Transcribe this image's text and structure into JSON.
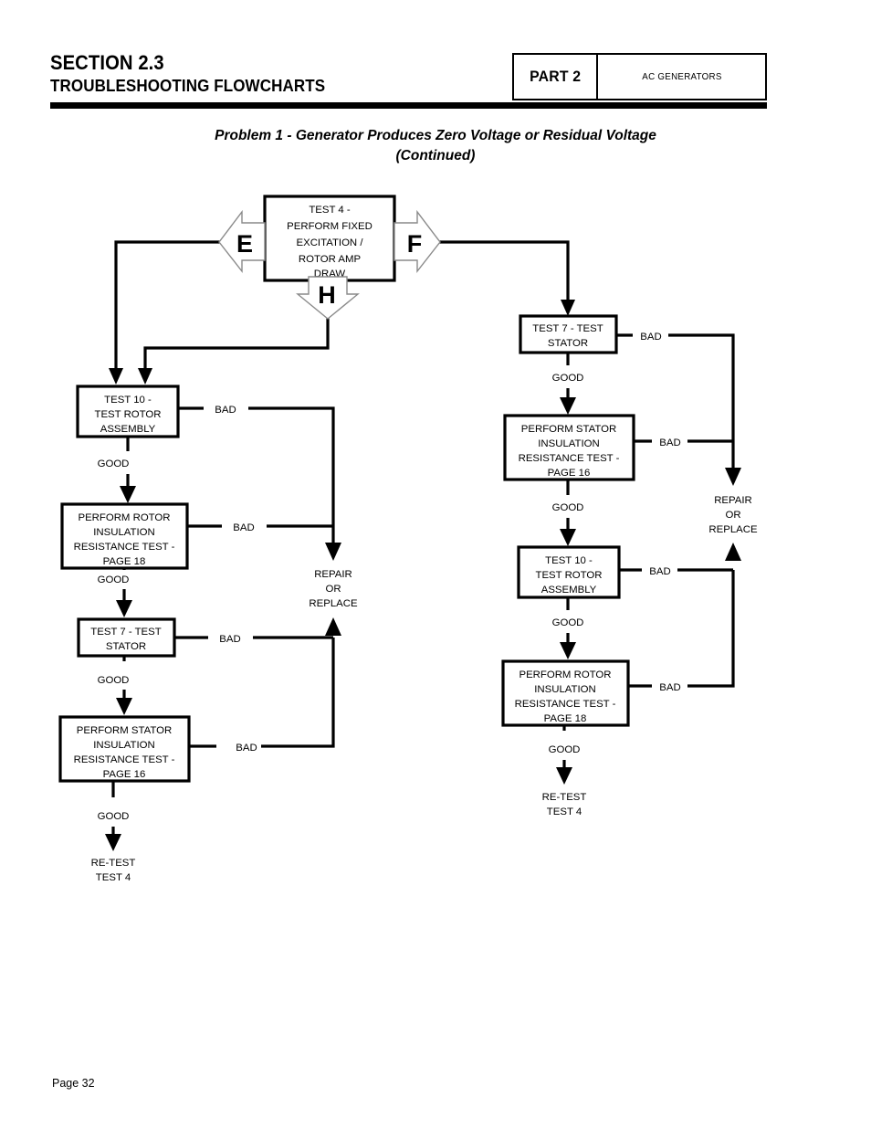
{
  "header": {
    "section_number": "SECTION 2.3",
    "section_subtitle": "TROUBLESHOOTING FLOWCHARTS",
    "part_label": "PART 2",
    "part_description": "AC GENERATORS"
  },
  "problem_title": {
    "line1": "Problem 1 - Generator Produces Zero Voltage or Residual Voltage",
    "line2": "(Continued)"
  },
  "footer": {
    "page": "Page 32"
  },
  "chart_data": {
    "type": "diagram",
    "title": "Problem 1 - Generator Produces Zero Voltage or Residual Voltage (Continued)",
    "diagram_kind": "troubleshooting-flowchart",
    "nodes": [
      {
        "id": "test4",
        "kind": "process",
        "lines": [
          "TEST 4 -",
          "PERFORM FIXED",
          "EXCITATION /",
          "ROTOR AMP",
          "DRAW"
        ]
      },
      {
        "id": "connE",
        "kind": "connector",
        "letter": "E",
        "direction": "left"
      },
      {
        "id": "connF",
        "kind": "connector",
        "letter": "F",
        "direction": "right"
      },
      {
        "id": "connH",
        "kind": "connector",
        "letter": "H",
        "direction": "down"
      },
      {
        "id": "L1",
        "kind": "process",
        "lines": [
          "TEST 10 -",
          "TEST ROTOR",
          "ASSEMBLY"
        ]
      },
      {
        "id": "L2",
        "kind": "process",
        "lines": [
          "PERFORM ROTOR",
          "INSULATION",
          "RESISTANCE TEST -",
          "PAGE  18"
        ]
      },
      {
        "id": "L3",
        "kind": "process",
        "lines": [
          "TEST 7 - TEST",
          "STATOR"
        ]
      },
      {
        "id": "L4",
        "kind": "process",
        "lines": [
          "PERFORM STATOR",
          "INSULATION",
          "RESISTANCE TEST -",
          "PAGE  16"
        ]
      },
      {
        "id": "L5",
        "kind": "terminal",
        "lines": [
          "RE-TEST",
          "TEST 4"
        ]
      },
      {
        "id": "Lrepair",
        "kind": "terminal",
        "lines": [
          "REPAIR",
          "OR",
          "REPLACE"
        ]
      },
      {
        "id": "R1",
        "kind": "process",
        "lines": [
          "TEST 7 - TEST",
          "STATOR"
        ]
      },
      {
        "id": "R2",
        "kind": "process",
        "lines": [
          "PERFORM STATOR",
          "INSULATION",
          "RESISTANCE TEST -",
          "PAGE  16"
        ]
      },
      {
        "id": "R3",
        "kind": "process",
        "lines": [
          "TEST 10 -",
          "TEST ROTOR",
          "ASSEMBLY"
        ]
      },
      {
        "id": "R4",
        "kind": "process",
        "lines": [
          "PERFORM ROTOR",
          "INSULATION",
          "RESISTANCE TEST -",
          "PAGE  18"
        ]
      },
      {
        "id": "R5",
        "kind": "terminal",
        "lines": [
          "RE-TEST",
          "TEST 4"
        ]
      },
      {
        "id": "Rrepair",
        "kind": "terminal",
        "lines": [
          "REPAIR",
          "OR",
          "REPLACE"
        ]
      }
    ],
    "edges": [
      {
        "from": "connE",
        "to": "L1",
        "label": ""
      },
      {
        "from": "connH",
        "to": "L1",
        "label": ""
      },
      {
        "from": "connF",
        "to": "R1",
        "label": ""
      },
      {
        "from": "L1",
        "to": "Lrepair",
        "label": "BAD"
      },
      {
        "from": "L1",
        "to": "L2",
        "label": "GOOD"
      },
      {
        "from": "L2",
        "to": "Lrepair",
        "label": "BAD"
      },
      {
        "from": "L2",
        "to": "L3",
        "label": "GOOD"
      },
      {
        "from": "L3",
        "to": "Lrepair",
        "label": "BAD"
      },
      {
        "from": "L3",
        "to": "L4",
        "label": "GOOD"
      },
      {
        "from": "L4",
        "to": "Lrepair",
        "label": "BAD"
      },
      {
        "from": "L4",
        "to": "L5",
        "label": "GOOD"
      },
      {
        "from": "R1",
        "to": "Rrepair",
        "label": "BAD"
      },
      {
        "from": "R1",
        "to": "R2",
        "label": "GOOD"
      },
      {
        "from": "R2",
        "to": "Rrepair",
        "label": "BAD"
      },
      {
        "from": "R2",
        "to": "R3",
        "label": "GOOD"
      },
      {
        "from": "R3",
        "to": "Rrepair",
        "label": "BAD"
      },
      {
        "from": "R3",
        "to": "R4",
        "label": "GOOD"
      },
      {
        "from": "R4",
        "to": "Rrepair",
        "label": "BAD"
      },
      {
        "from": "R4",
        "to": "R5",
        "label": "GOOD"
      }
    ]
  },
  "flow": {
    "test4": {
      "l1": "TEST 4 -",
      "l2": "PERFORM FIXED",
      "l3": "EXCITATION /",
      "l4": "ROTOR AMP",
      "l5": "DRAW"
    },
    "conn_e": "E",
    "conn_f": "F",
    "conn_h": "H",
    "left": {
      "n1": {
        "l1": "TEST 10 -",
        "l2": "TEST ROTOR",
        "l3": "ASSEMBLY"
      },
      "n1_bad": "BAD",
      "n1_good": "GOOD",
      "n2": {
        "l1": "PERFORM ROTOR",
        "l2": "INSULATION",
        "l3": "RESISTANCE TEST -",
        "l4": "PAGE  18"
      },
      "n2_bad": "BAD",
      "n2_good": "GOOD",
      "n3": {
        "l1": "TEST 7 - TEST",
        "l2": "STATOR"
      },
      "n3_bad": "BAD",
      "n3_good": "GOOD",
      "n4": {
        "l1": "PERFORM STATOR",
        "l2": "INSULATION",
        "l3": "RESISTANCE TEST -",
        "l4": "PAGE  16"
      },
      "n4_bad": "BAD",
      "n4_good": "GOOD",
      "end": {
        "l1": "RE-TEST",
        "l2": "TEST 4"
      },
      "repair": {
        "l1": "REPAIR",
        "l2": "OR",
        "l3": "REPLACE"
      }
    },
    "right": {
      "n1": {
        "l1": "TEST 7 - TEST",
        "l2": "STATOR"
      },
      "n1_bad": "BAD",
      "n1_good": "GOOD",
      "n2": {
        "l1": "PERFORM STATOR",
        "l2": "INSULATION",
        "l3": "RESISTANCE TEST -",
        "l4": "PAGE  16"
      },
      "n2_bad": "BAD",
      "n2_good": "GOOD",
      "n3": {
        "l1": "TEST 10 -",
        "l2": "TEST ROTOR",
        "l3": "ASSEMBLY"
      },
      "n3_bad": "BAD",
      "n3_good": "GOOD",
      "n4": {
        "l1": "PERFORM ROTOR",
        "l2": "INSULATION",
        "l3": "RESISTANCE TEST -",
        "l4": "PAGE  18"
      },
      "n4_bad": "BAD",
      "n4_good": "GOOD",
      "end": {
        "l1": "RE-TEST",
        "l2": "TEST 4"
      },
      "repair": {
        "l1": "REPAIR",
        "l2": "OR",
        "l3": "REPLACE"
      }
    }
  }
}
